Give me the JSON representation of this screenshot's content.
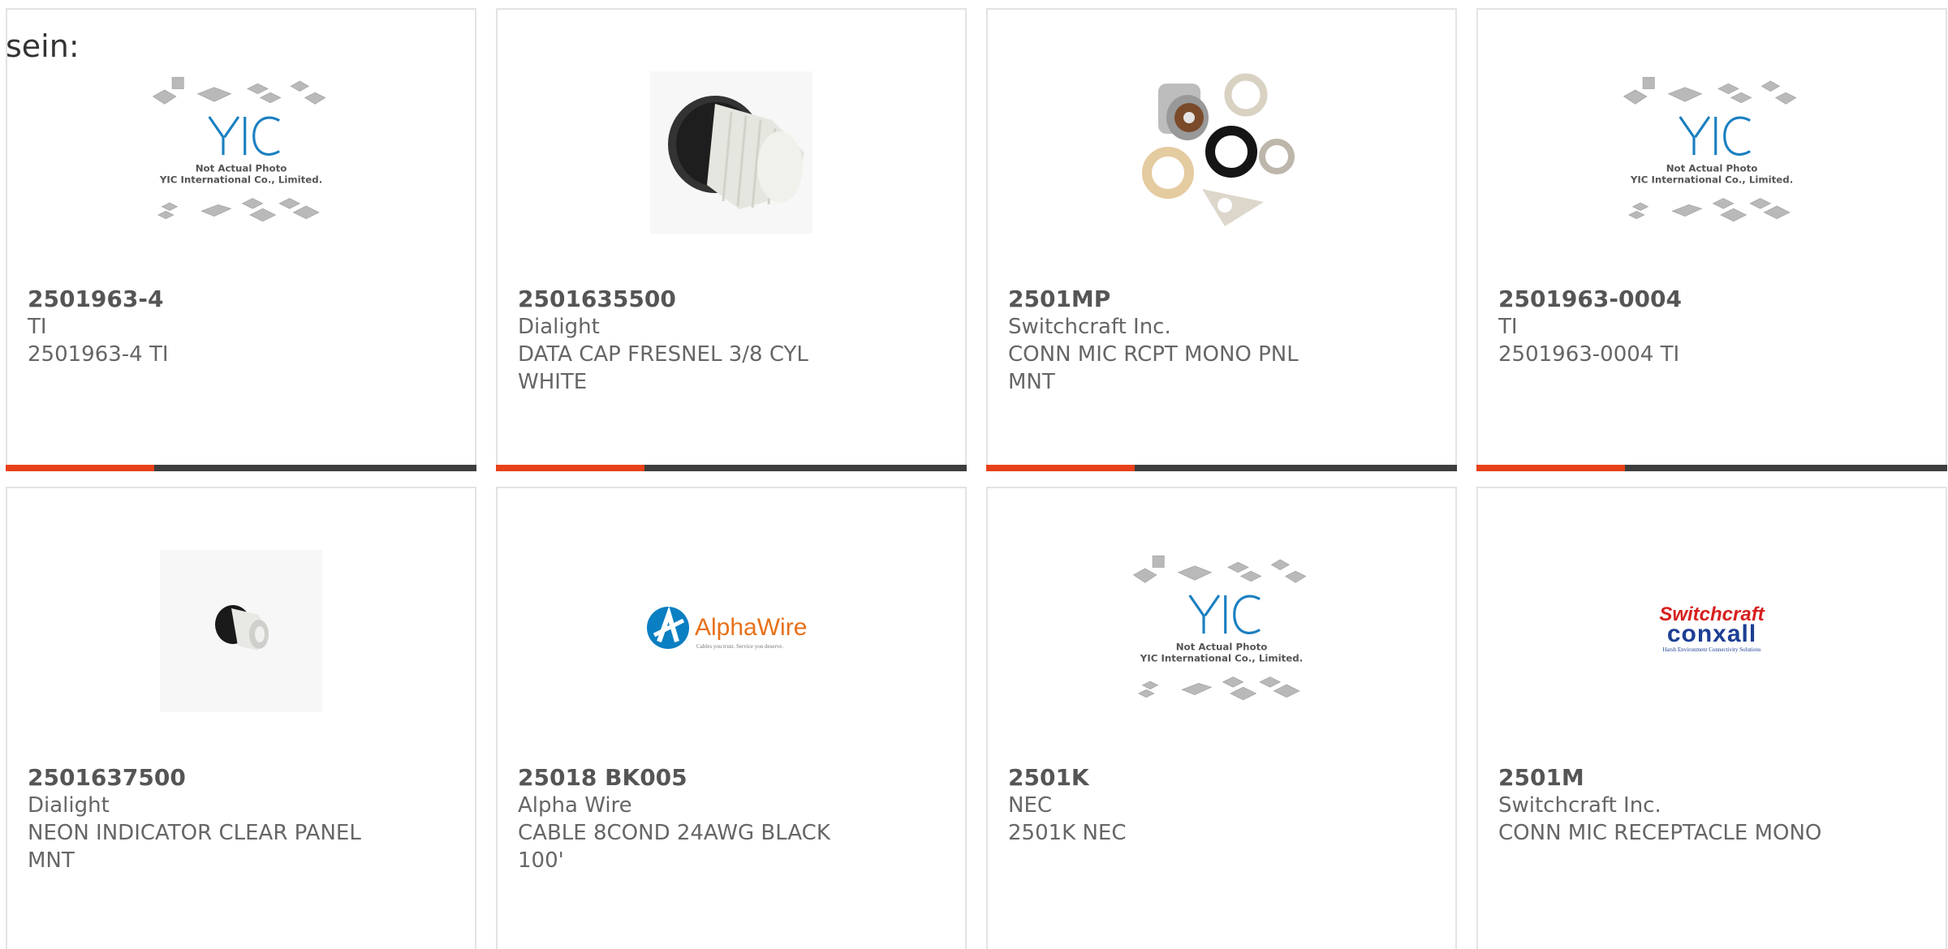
{
  "page": {
    "lead_text": "sein:"
  },
  "colors": {
    "accent": "#e8411a",
    "bar": "#3d3d3d",
    "text": "#666666",
    "border": "#e3e3e3"
  },
  "watermark": {
    "logo": "YIC",
    "line1": "Not Actual Photo",
    "line2": "YIC International Co., Limited."
  },
  "products": [
    {
      "part_number": "2501963-4",
      "manufacturer": "TI",
      "description": "2501963-4 TI",
      "image": "yic-placeholder-image"
    },
    {
      "part_number": "2501635500",
      "manufacturer": "Dialight",
      "description": "DATA CAP FRESNEL 3/8 CYL WHITE",
      "image": "fresnel-cap-photo"
    },
    {
      "part_number": "2501MP",
      "manufacturer": "Switchcraft Inc.",
      "description": "CONN MIC RCPT MONO PNL MNT",
      "image": "mic-connector-kit-photo"
    },
    {
      "part_number": "2501963-0004",
      "manufacturer": "TI",
      "description": "2501963-0004 TI",
      "image": "yic-placeholder-image"
    },
    {
      "part_number": "2501637500",
      "manufacturer": "Dialight",
      "description": "NEON INDICATOR CLEAR PANEL MNT",
      "image": "neon-indicator-photo"
    },
    {
      "part_number": "25018 BK005",
      "manufacturer": "Alpha Wire",
      "description": "CABLE 8COND 24AWG BLACK 100'",
      "image": "alphawire-logo"
    },
    {
      "part_number": "2501K",
      "manufacturer": "NEC",
      "description": "2501K NEC",
      "image": "yic-placeholder-image"
    },
    {
      "part_number": "2501M",
      "manufacturer": "Switchcraft Inc.",
      "description": "CONN MIC RECEPTACLE MONO",
      "image": "switchcraft-conxall-logo"
    }
  ],
  "brand_logos": {
    "alphawire": {
      "name": "AlphaWire",
      "tagline": "Cables you trust. Service you deserve."
    },
    "switchcraft": {
      "line1": "Switchcraft",
      "line2": "conxall",
      "tagline": "Harsh Environment Connectivity Solutions"
    }
  }
}
